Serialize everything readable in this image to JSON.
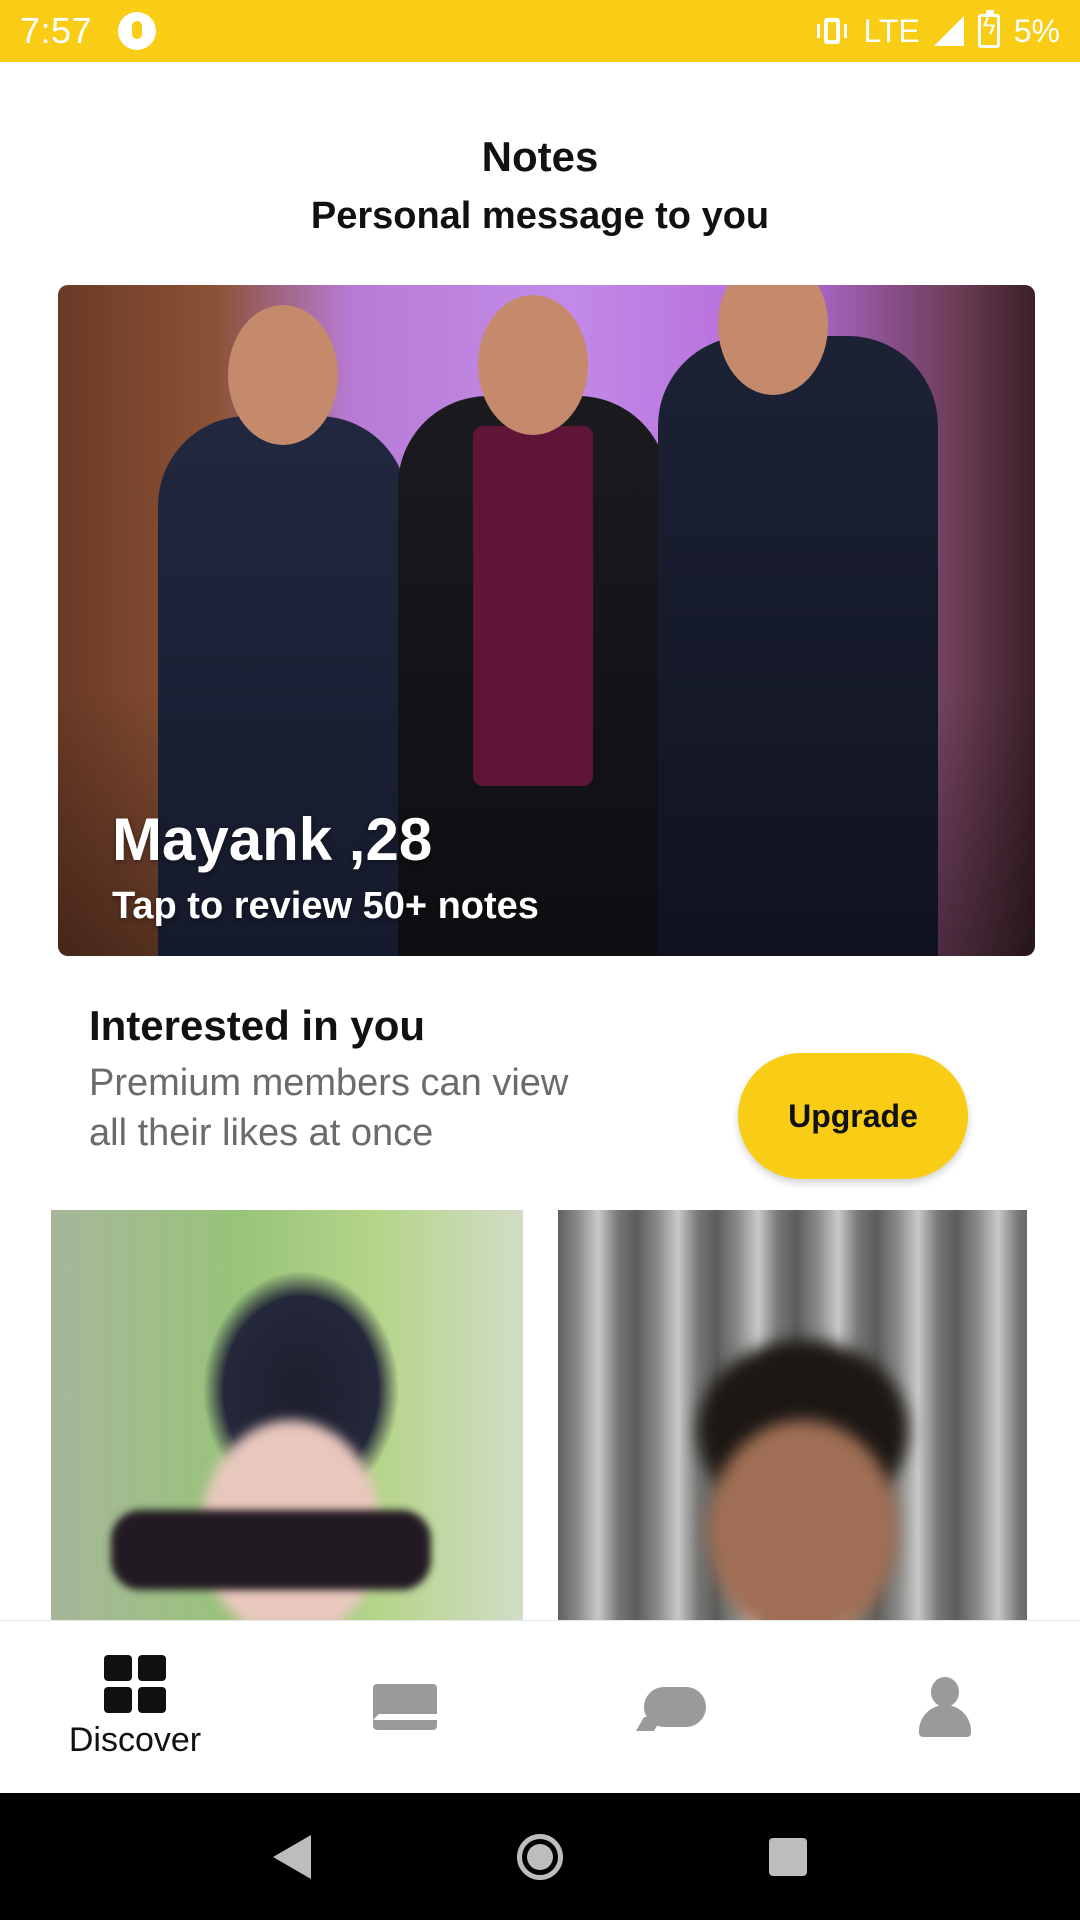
{
  "status_bar": {
    "time": "7:57",
    "network": "LTE",
    "battery_percent": "5%",
    "background_color": "#F9CC16"
  },
  "header": {
    "title": "Notes",
    "subtitle": "Personal message to you"
  },
  "hero_card": {
    "name_age": "Mayank ,28",
    "action_text": "Tap to review 50+ notes"
  },
  "interested": {
    "title": "Interested in you",
    "description_line1": "Premium members can view",
    "description_line2": "all their likes at once",
    "upgrade_label": "Upgrade",
    "accent_color": "#F9CC16"
  },
  "bottom_nav": {
    "items": [
      {
        "label": "Discover",
        "icon": "grid-icon",
        "active": true
      },
      {
        "label": "",
        "icon": "mail-icon",
        "active": false
      },
      {
        "label": "",
        "icon": "chat-icon",
        "active": false
      },
      {
        "label": "",
        "icon": "profile-icon",
        "active": false
      }
    ]
  },
  "system_nav": {
    "buttons": [
      "back-icon",
      "home-icon",
      "recents-icon"
    ]
  }
}
